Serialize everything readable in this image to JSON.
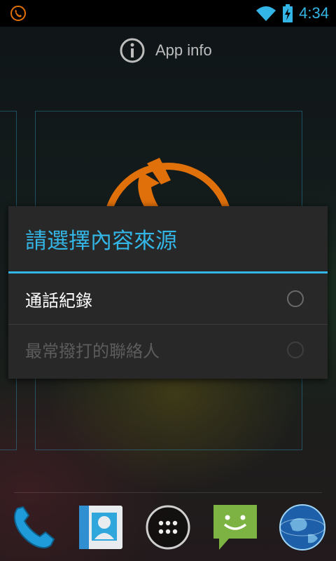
{
  "status_bar": {
    "time": "4:34",
    "icons": [
      "missed-call-icon",
      "wifi-icon",
      "battery-charging-icon"
    ],
    "accent_color": "#33b5e5"
  },
  "drop_target": {
    "label": "App info",
    "icon": "info-icon"
  },
  "dialog": {
    "title": "請選擇內容來源",
    "options": [
      {
        "label": "通話紀錄",
        "selected": false,
        "enabled": true
      },
      {
        "label": "最常撥打的聯絡人",
        "selected": false,
        "enabled": false
      }
    ]
  },
  "dock": {
    "items": [
      "phone-icon",
      "contacts-icon",
      "all-apps-icon",
      "messaging-icon",
      "browser-icon"
    ]
  },
  "colors": {
    "dialog_bg": "#282828",
    "accent": "#33b5e5",
    "widget_orange": "#e0700a"
  }
}
